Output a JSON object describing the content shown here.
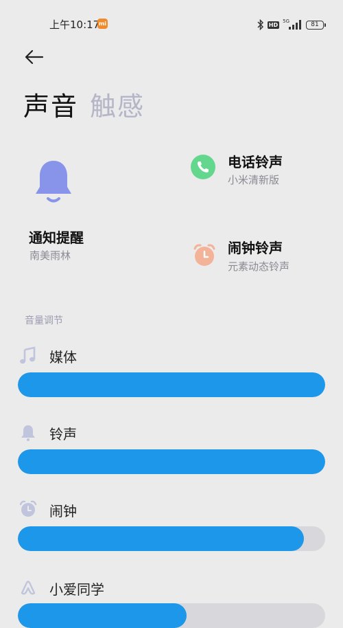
{
  "status_bar": {
    "time": "上午10:17",
    "mi_badge": "mi",
    "hd": "HD",
    "network": "5G",
    "battery": "81"
  },
  "header": {
    "tabs": [
      {
        "label": "声音",
        "active": true
      },
      {
        "label": "触感",
        "active": false
      }
    ]
  },
  "cards": {
    "notification": {
      "title": "通知提醒",
      "subtitle": "南美雨林"
    },
    "phone": {
      "title": "电话铃声",
      "subtitle": "小米清新版"
    },
    "alarm": {
      "title": "闹钟铃声",
      "subtitle": "元素动态铃声"
    }
  },
  "volume": {
    "header": "音量调节",
    "items": [
      {
        "label": "媒体",
        "icon": "music-note-icon",
        "level": 1.0
      },
      {
        "label": "铃声",
        "icon": "bell-icon",
        "level": 1.0
      },
      {
        "label": "闹钟",
        "icon": "alarm-clock-icon",
        "level": 0.93
      },
      {
        "label": "小爱同学",
        "icon": "xiaoai-icon",
        "level": 0.55
      }
    ]
  },
  "colors": {
    "accent": "#1c97ea",
    "bell": "#8794ea",
    "phone": "#63d78e",
    "alarm": "#f2b398",
    "inactive_tab": "#b4b6c8"
  }
}
